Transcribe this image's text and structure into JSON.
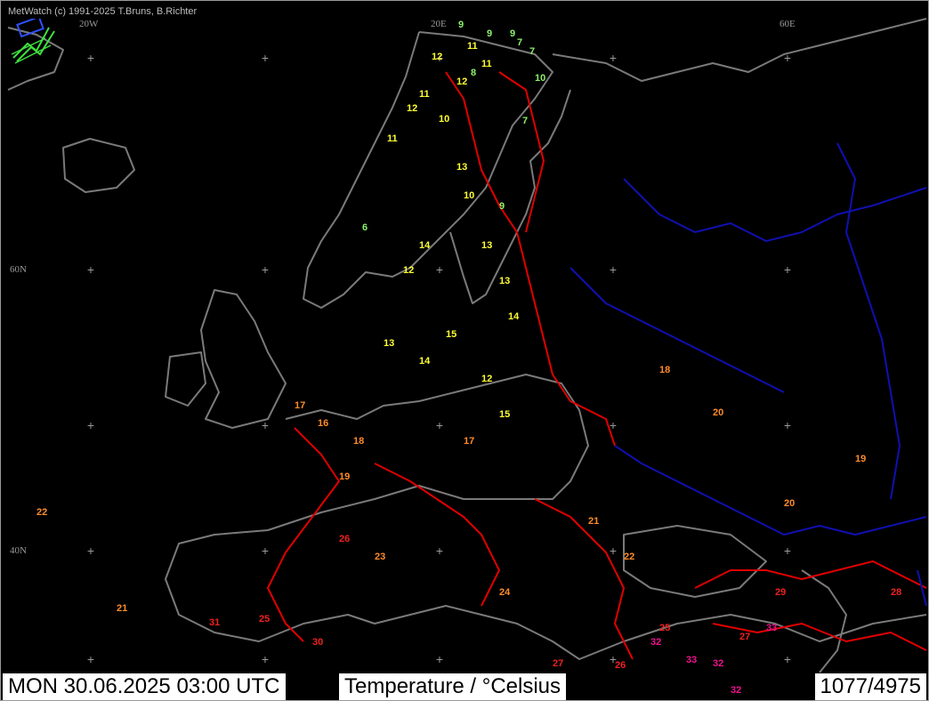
{
  "credit": "MetWatch  (c) 1991-2025 T.Bruns, B.Richter",
  "graticule_labels": [
    "20W",
    "20E",
    "60E",
    "60N",
    "40N"
  ],
  "status": {
    "datetime": "MON 30.06.2025 03:00 UTC",
    "parameter": "Temperature / °Celsius",
    "count": "1077/4975"
  },
  "colors": {
    "background": "#000000",
    "coast": "#7a7a7a",
    "border_west": "#e00000",
    "border_east": "#1010b0",
    "graticule": "#9a9a9a",
    "temp_cold": "#2aa52a",
    "temp_cool": "#8cf26b",
    "temp_mild": "#ffff33",
    "temp_warm": "#ff8c2a",
    "temp_hot": "#f02020",
    "temp_very_hot": "#f01090"
  },
  "icons": [
    "metwatch-logo-icon"
  ],
  "station_values": [
    {
      "v": "9",
      "c": "temp_cool"
    },
    {
      "v": "9",
      "c": "temp_cool"
    },
    {
      "v": "9",
      "c": "temp_cool"
    },
    {
      "v": "7",
      "c": "temp_cool"
    },
    {
      "v": "7",
      "c": "temp_cool"
    },
    {
      "v": "11",
      "c": "temp_mild"
    },
    {
      "v": "12",
      "c": "temp_mild"
    },
    {
      "v": "11",
      "c": "temp_mild"
    },
    {
      "v": "12",
      "c": "temp_mild"
    },
    {
      "v": "11",
      "c": "temp_mild"
    },
    {
      "v": "10",
      "c": "temp_mild"
    },
    {
      "v": "12",
      "c": "temp_mild"
    },
    {
      "v": "13",
      "c": "temp_mild"
    },
    {
      "v": "11",
      "c": "temp_mild"
    },
    {
      "v": "10",
      "c": "temp_mild"
    },
    {
      "v": "8",
      "c": "temp_cool"
    },
    {
      "v": "10",
      "c": "temp_cool"
    },
    {
      "v": "7",
      "c": "temp_cool"
    },
    {
      "v": "9",
      "c": "temp_cool"
    },
    {
      "v": "6",
      "c": "temp_cool"
    },
    {
      "v": "13",
      "c": "temp_mild"
    },
    {
      "v": "14",
      "c": "temp_mild"
    },
    {
      "v": "12",
      "c": "temp_mild"
    },
    {
      "v": "13",
      "c": "temp_mild"
    },
    {
      "v": "14",
      "c": "temp_mild"
    },
    {
      "v": "15",
      "c": "temp_mild"
    },
    {
      "v": "13",
      "c": "temp_mild"
    },
    {
      "v": "14",
      "c": "temp_mild"
    },
    {
      "v": "12",
      "c": "temp_mild"
    },
    {
      "v": "15",
      "c": "temp_mild"
    },
    {
      "v": "16",
      "c": "temp_warm"
    },
    {
      "v": "17",
      "c": "temp_warm"
    },
    {
      "v": "18",
      "c": "temp_warm"
    },
    {
      "v": "19",
      "c": "temp_warm"
    },
    {
      "v": "17",
      "c": "temp_warm"
    },
    {
      "v": "18",
      "c": "temp_warm"
    },
    {
      "v": "20",
      "c": "temp_warm"
    },
    {
      "v": "19",
      "c": "temp_warm"
    },
    {
      "v": "21",
      "c": "temp_warm"
    },
    {
      "v": "22",
      "c": "temp_warm"
    },
    {
      "v": "23",
      "c": "temp_warm"
    },
    {
      "v": "24",
      "c": "temp_warm"
    },
    {
      "v": "22",
      "c": "temp_warm"
    },
    {
      "v": "21",
      "c": "temp_warm"
    },
    {
      "v": "20",
      "c": "temp_warm"
    },
    {
      "v": "25",
      "c": "temp_hot"
    },
    {
      "v": "26",
      "c": "temp_hot"
    },
    {
      "v": "27",
      "c": "temp_hot"
    },
    {
      "v": "28",
      "c": "temp_hot"
    },
    {
      "v": "29",
      "c": "temp_hot"
    },
    {
      "v": "30",
      "c": "temp_hot"
    },
    {
      "v": "31",
      "c": "temp_hot"
    },
    {
      "v": "25",
      "c": "temp_hot"
    },
    {
      "v": "26",
      "c": "temp_hot"
    },
    {
      "v": "27",
      "c": "temp_hot"
    },
    {
      "v": "32",
      "c": "temp_very_hot"
    },
    {
      "v": "33",
      "c": "temp_very_hot"
    },
    {
      "v": "32",
      "c": "temp_very_hot"
    },
    {
      "v": "33",
      "c": "temp_very_hot"
    },
    {
      "v": "32",
      "c": "temp_very_hot"
    }
  ]
}
